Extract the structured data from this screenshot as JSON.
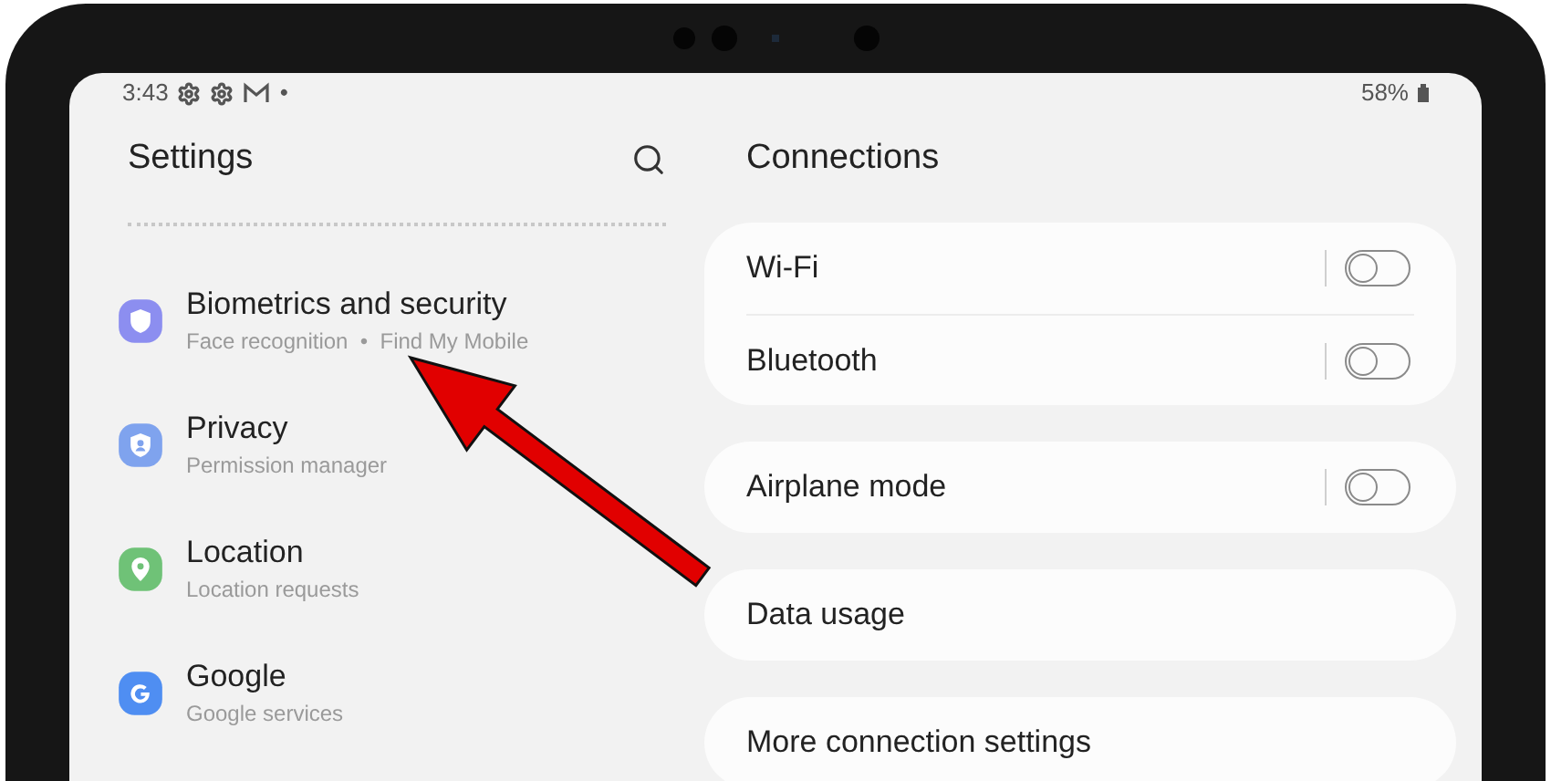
{
  "status_bar": {
    "time": "3:43",
    "notification_dot": "•",
    "battery": "58%"
  },
  "settings_panel": {
    "title": "Settings",
    "items": [
      {
        "title": "Biometrics and security",
        "subtitle": "Face recognition  •  Find My Mobile",
        "color": "#8c8ef0"
      },
      {
        "title": "Privacy",
        "subtitle": "Permission manager",
        "color": "#7fa3ee"
      },
      {
        "title": "Location",
        "subtitle": "Location requests",
        "color": "#6fc277"
      },
      {
        "title": "Google",
        "subtitle": "Google services",
        "color": "#4f8ef2"
      }
    ]
  },
  "connections_panel": {
    "title": "Connections",
    "groups": [
      [
        {
          "label": "Wi-Fi",
          "kind": "toggle",
          "on": false
        },
        {
          "label": "Bluetooth",
          "kind": "toggle",
          "on": false
        }
      ],
      [
        {
          "label": "Airplane mode",
          "kind": "toggle",
          "on": false
        }
      ],
      [
        {
          "label": "Data usage",
          "kind": "link"
        }
      ],
      [
        {
          "label": "More connection settings",
          "kind": "link"
        }
      ]
    ]
  }
}
